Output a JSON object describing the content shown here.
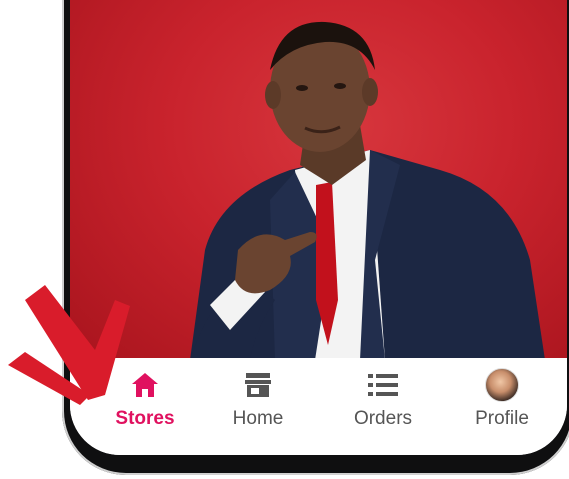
{
  "colors": {
    "accent": "#e0115f",
    "photo_background": "#c9232d",
    "arrow": "#d91c2b"
  },
  "bottom_nav": {
    "items": [
      {
        "label": "Stores",
        "icon": "home-icon",
        "active": true
      },
      {
        "label": "Home",
        "icon": "store-icon",
        "active": false
      },
      {
        "label": "Orders",
        "icon": "list-icon",
        "active": false
      },
      {
        "label": "Profile",
        "icon": "avatar",
        "active": false
      }
    ]
  }
}
